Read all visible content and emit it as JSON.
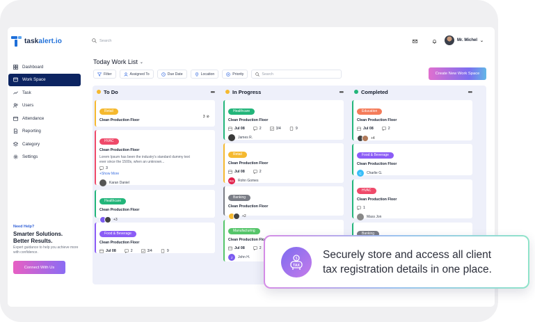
{
  "brand": {
    "name_prefix": "task",
    "name_suffix": "alert.io"
  },
  "sidebar": {
    "items": [
      {
        "label": "Dashboard",
        "icon": "dashboard-icon",
        "active": false
      },
      {
        "label": "Work Space",
        "icon": "workspace-icon",
        "active": true
      },
      {
        "label": "Task",
        "icon": "trend-icon",
        "active": false
      },
      {
        "label": "Users",
        "icon": "users-icon",
        "active": false
      },
      {
        "label": "Attendance",
        "icon": "calendar-icon",
        "active": false
      },
      {
        "label": "Reporting",
        "icon": "document-icon",
        "active": false
      },
      {
        "label": "Category",
        "icon": "category-icon",
        "active": false
      },
      {
        "label": "Settings",
        "icon": "gear-icon",
        "active": false
      }
    ],
    "help": {
      "kicker": "Need Help?",
      "headline_1": "Smarter Solutions.",
      "headline_2": "Better Results.",
      "body": "Expert guidance to help you achieve more with confidence.",
      "cta": "Connect With Us"
    }
  },
  "topbar": {
    "search_placeholder": "Search",
    "user_name": "Mr. Michel"
  },
  "main": {
    "title": "Today Work List",
    "filters": [
      "Filter",
      "Assigned To",
      "Due Date",
      "Location",
      "Priority"
    ],
    "search_placeholder": "Search",
    "new_button": "Create New Work Space"
  },
  "columns": [
    {
      "name": "To Do",
      "dot_color": "#f5b92f",
      "cards": [
        {
          "tag": "Retail",
          "tag_color": "#f5b92f",
          "title": "Clean Production Floor",
          "count": "3"
        },
        {
          "tag": "HVAC",
          "tag_color": "#ef4a6a",
          "title": "Clean Production Floor",
          "desc": "Lorem Ipsum has been the industry's standard dummy text ever since the 1500s, when an unknown...",
          "comments": "3",
          "show_more": "+Show More",
          "person": "Karan Daniel"
        },
        {
          "tag": "Healthcare",
          "tag_color": "#22b57a",
          "title": "Clean Production Floor",
          "extra": "+3"
        },
        {
          "tag": "Food & Beverage",
          "tag_color": "#8b5cf6",
          "title": "Clean Production Floor",
          "date": "Jul 08",
          "comments": "2",
          "checklist": "3/4",
          "attachments": "9"
        }
      ]
    },
    {
      "name": "In Progress",
      "dot_color": "#f5b92f",
      "cards": [
        {
          "tag": "Healthcare",
          "tag_color": "#22b57a",
          "title": "Clean Production Floor",
          "date": "Jul 08",
          "comments": "2",
          "checklist": "3/4",
          "attachments": "9",
          "person": "James R."
        },
        {
          "tag": "Retail",
          "tag_color": "#f5b92f",
          "title": "Clean Production Floor",
          "date": "Jul 08",
          "comments": "2",
          "person": "Rohn Gomes",
          "initials": "RG"
        },
        {
          "tag": "Banking",
          "tag_color": "#7a7d86",
          "title": "Clean Production Floor",
          "extra": "+2"
        },
        {
          "tag": "Manufacturing",
          "tag_color": "#55c56a",
          "title": "Clean Production Floor",
          "date": "Jul 08",
          "comments": "2",
          "person": "John H.",
          "initials": "J"
        }
      ]
    },
    {
      "name": "Completed",
      "dot_color": "#22b57a",
      "cards": [
        {
          "tag": "Education",
          "tag_color": "#f47c5a",
          "title": "Clean Production Floor",
          "date": "Jul 08",
          "comments": "2",
          "extra": "+4"
        },
        {
          "tag": "Food & Beverage",
          "tag_color": "#8b5cf6",
          "title": "Clean Production Floor",
          "person": "Charlie G.",
          "initials": "C"
        },
        {
          "tag": "HVAC",
          "tag_color": "#ef4a6a",
          "title": "Clean Production Floor",
          "comments": "1",
          "person": "Mass Jon"
        },
        {
          "tag": "Banking",
          "tag_color": "#7a7d86"
        }
      ]
    }
  ],
  "callout": {
    "text_1": "Securely store and access all client",
    "text_2": "tax registration details in one place.",
    "icon_label": "TAX"
  }
}
